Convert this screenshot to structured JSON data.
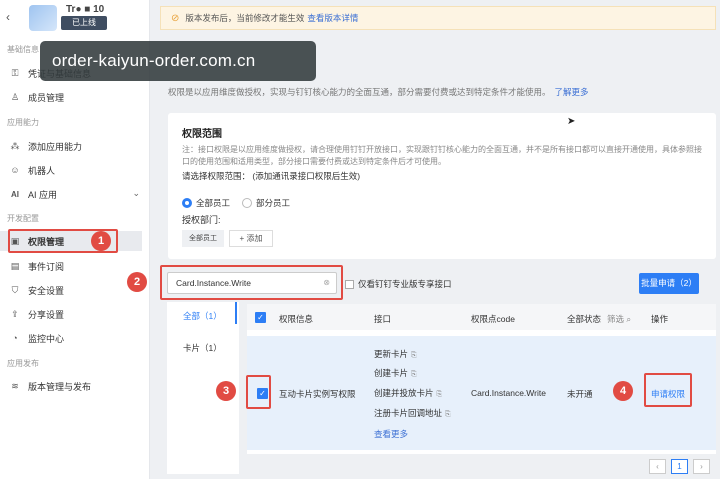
{
  "app": {
    "back": "‹",
    "name": "Tr● ■ 10",
    "status": "已上线"
  },
  "sidebar": {
    "groups": [
      "基础信息",
      "应用能力",
      "开发配置",
      "应用发布"
    ],
    "items": [
      {
        "label": "凭证与基础信息",
        "icon": "key-icon"
      },
      {
        "label": "成员管理",
        "icon": "user-icon"
      },
      {
        "label": "添加应用能力",
        "icon": "puzzle-icon"
      },
      {
        "label": "机器人",
        "icon": "robot-icon"
      },
      {
        "label": "AI 应用",
        "icon": "ai-icon"
      },
      {
        "label": "权限管理",
        "icon": "permission-icon"
      },
      {
        "label": "事件订阅",
        "icon": "event-icon"
      },
      {
        "label": "安全设置",
        "icon": "shield-icon"
      },
      {
        "label": "分享设置",
        "icon": "share-icon"
      },
      {
        "label": "监控中心",
        "icon": "monitor-icon"
      },
      {
        "label": "版本管理与发布",
        "icon": "layers-icon"
      }
    ]
  },
  "banner": {
    "text": "版本发布后，当前修改才能生效",
    "link": "查看版本详情"
  },
  "watermark": "order-kaiyun-order.com.cn",
  "description": {
    "text": "权限是以应用维度做授权，实现与钉钉核心能力的全面互通，部分需要付费或达到特定条件才能使用。",
    "link": "了解更多"
  },
  "scope": {
    "title": "权限范围",
    "note": "注：接口权限是以应用维度做授权，请合理使用钉钉开放接口，实现跟钉钉核心能力的全面互通，并不是所有接口都可以直接开通使用，具体参照接口的使用范围和适用类型，部分接口需要付费或达到特定条件后才可使用。",
    "choose": "请选择权限范围： (添加通讯录接口权限后生效)",
    "radio_all": "全部员工",
    "radio_part": "部分员工",
    "dept_label": "授权部门:",
    "dept_tag": "全部员工",
    "add": "+ 添加"
  },
  "search": {
    "value": "Card.Instance.Write",
    "clear": "⊗"
  },
  "pro_only": "仅看钉钉专业版专享接口",
  "bulk_apply": "批量申请（2）",
  "filter": {
    "all": "全部（1）",
    "card": "卡片（1）"
  },
  "table": {
    "headers": [
      "权限信息",
      "接口",
      "权限点code",
      "全部状态",
      "筛选",
      "操作"
    ],
    "row": {
      "name": "互动卡片实例写权限",
      "apis": [
        "更新卡片",
        "创建卡片",
        "创建并投放卡片",
        "注册卡片回调地址"
      ],
      "more": "查看更多",
      "code": "Card.Instance.Write",
      "status": "未开通",
      "action": "申请权限"
    }
  },
  "annotations": [
    "1",
    "2",
    "3",
    "4"
  ],
  "pager": {
    "prev": "‹",
    "page": "1",
    "next": "›"
  }
}
